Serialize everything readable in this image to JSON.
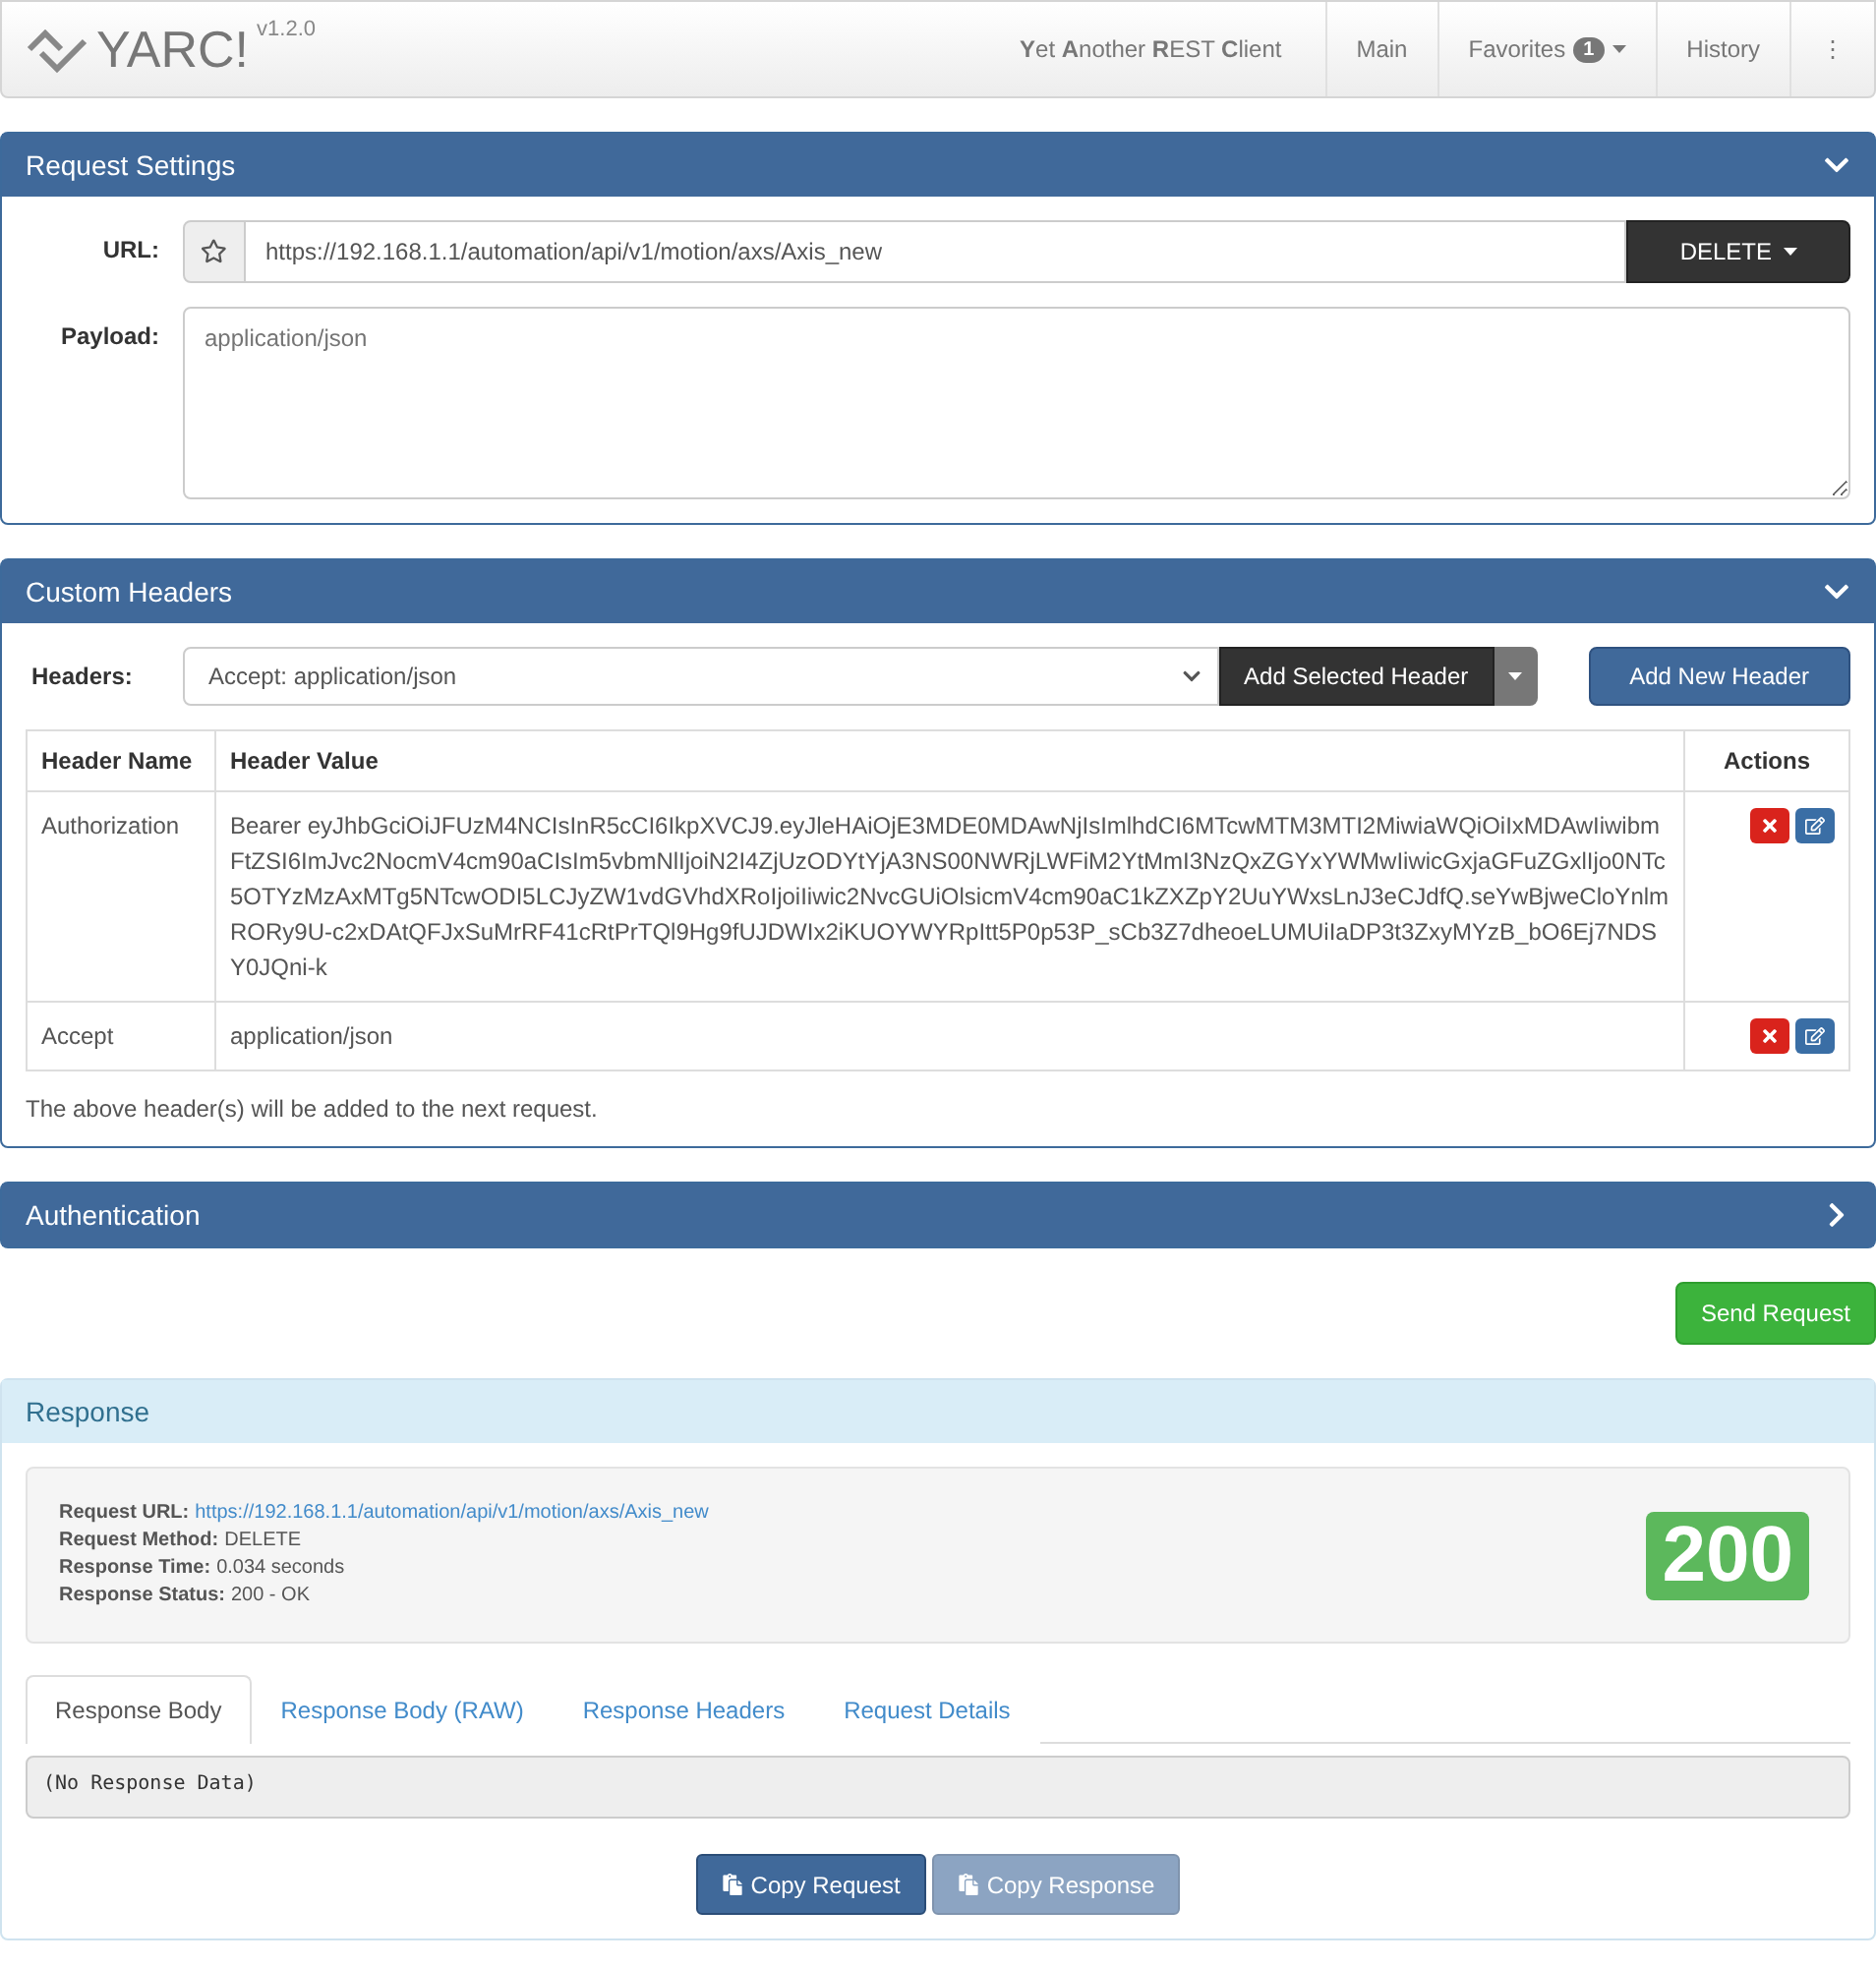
{
  "navbar": {
    "brand": "YARC!",
    "version": "v1.2.0",
    "tagline": "**Y**et **A**nother **R**EST **C**lient",
    "items": [
      {
        "label": "Main"
      },
      {
        "label": "Favorites",
        "badge": "1"
      },
      {
        "label": "History"
      }
    ],
    "more": "⋮"
  },
  "request_settings": {
    "title": "Request Settings",
    "expanded": true,
    "url_label": "URL:",
    "url": "https://192.168.1.1/automation/api/v1/motion/axs/Axis_new",
    "favorite": false,
    "method": "DELETE",
    "payload_label": "Payload:",
    "payload_placeholder": "application/json"
  },
  "custom_headers": {
    "title": "Custom Headers",
    "expanded": true,
    "headers_label": "Headers:",
    "selected_header": "Accept: application/json",
    "add_selected": "Add Selected Header",
    "add_new": "Add New Header",
    "columns": [
      "Header Name",
      "Header Value",
      "Actions"
    ],
    "rows": [
      {
        "name": "Authorization",
        "value": "Bearer eyJhbGciOiJFUzM4NCIsInR5cCI6IkpXVCJ9.eyJleHAiOjE3MDE0MDAwNjIsImlhdCI6MTcwMTM3MTI2MiwiaWQiOiIxMDAwIiwibmFtZSI6ImJvc2NocmV4cm90aCIsIm5vbmNlIjoiN2I4ZjUzODYtYjA3NS00NWRjLWFiM2YtMmI3NzQxZGYxYWMwIiwicGxjaGFuZGxlIjo0NTc5OTYzMzAxMTg5NTcwODI5LCJyZW1vdGVhdXRoIjoiIiwic2NvcGUiOlsicmV4cm90aC1kZXZpY2UuYWxsLnJ3eCJdfQ.seYwBjweCloYnlmRORy9U-c2xDAtQFJxSuMrRF41cRtPrTQl9Hg9fUJDWIx2iKUOYWYRpItt5P0p53P_sCb3Z7dheoeLUMUiIaDP3t3ZxyMYzB_bO6Ej7NDSY0JQni-k"
      },
      {
        "name": "Accept",
        "value": "application/json"
      }
    ],
    "note": "The above header(s) will be added to the next request."
  },
  "authentication": {
    "title": "Authentication",
    "expanded": false
  },
  "send_button": "Send Request",
  "response": {
    "title": "Response",
    "details": [
      {
        "label": "Request URL:",
        "value": "https://192.168.1.1/automation/api/v1/motion/axs/Axis_new",
        "kind": "link"
      },
      {
        "label": "Request Method:",
        "value": "DELETE",
        "kind": "text"
      },
      {
        "label": "Response Time:",
        "value": "0.034 seconds",
        "kind": "text"
      },
      {
        "label": "Response Status:",
        "value": "200 - OK",
        "kind": "text"
      }
    ],
    "status_code": "200",
    "tabs": [
      {
        "label": "Response Body",
        "selected": true
      },
      {
        "label": "Response Body (RAW)",
        "selected": false
      },
      {
        "label": "Response Headers",
        "selected": false
      },
      {
        "label": "Request Details",
        "selected": false
      }
    ],
    "body": "(No Response Data)",
    "buttons": [
      {
        "label": "Copy Request",
        "disabled": false
      },
      {
        "label": "Copy Response",
        "disabled": true
      }
    ]
  }
}
